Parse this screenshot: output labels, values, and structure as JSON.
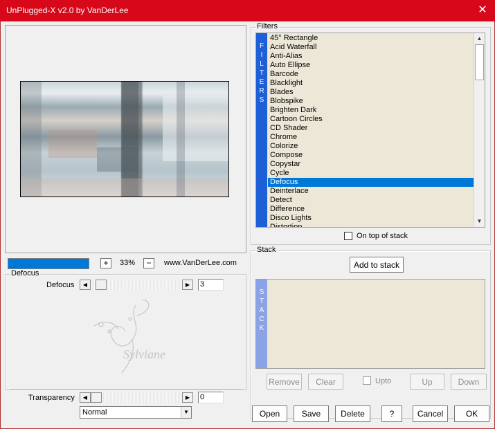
{
  "window": {
    "title": "UnPlugged-X v2.0 by VanDerLee"
  },
  "preview": {
    "zoom": "33%",
    "website": "www.VanDerLee.com",
    "progress": 1.0
  },
  "filters": {
    "group_label": "Filters",
    "tab_label": "FILTERS",
    "items": [
      "45° Rectangle",
      "Acid Waterfall",
      "Anti-Alias",
      "Auto Ellipse",
      "Barcode",
      "Blacklight",
      "Blades",
      "Blobspike",
      "Brighten Dark",
      "Cartoon Circles",
      "CD Shader",
      "Chrome",
      "Colorize",
      "Compose",
      "Copystar",
      "Cycle",
      "Defocus",
      "Deinterlace",
      "Detect",
      "Difference",
      "Disco Lights",
      "Distortion"
    ],
    "selected": "Defocus",
    "on_top_label": "On top of stack"
  },
  "stack": {
    "group_label": "Stack",
    "tab_label": "STACK",
    "add_button": "Add to stack",
    "remove_button": "Remove",
    "clear_button": "Clear",
    "upto_label": "Upto",
    "up_button": "Up",
    "down_button": "Down"
  },
  "params": {
    "group_label": "Defocus",
    "defocus_label": "Defocus",
    "defocus_value": "3",
    "transparency_label": "Transparency",
    "transparency_value": "0",
    "blend_mode": "Normal"
  },
  "watermark": {
    "text": "Sylviane"
  },
  "buttons": {
    "open": "Open",
    "save": "Save",
    "delete": "Delete",
    "help": "?",
    "cancel": "Cancel",
    "ok": "OK"
  },
  "colors": {
    "titlebar": "#d6081a",
    "selection": "#0078d7",
    "filters_tab": "#1d5fd6",
    "stack_tab": "#8aa2e6"
  }
}
